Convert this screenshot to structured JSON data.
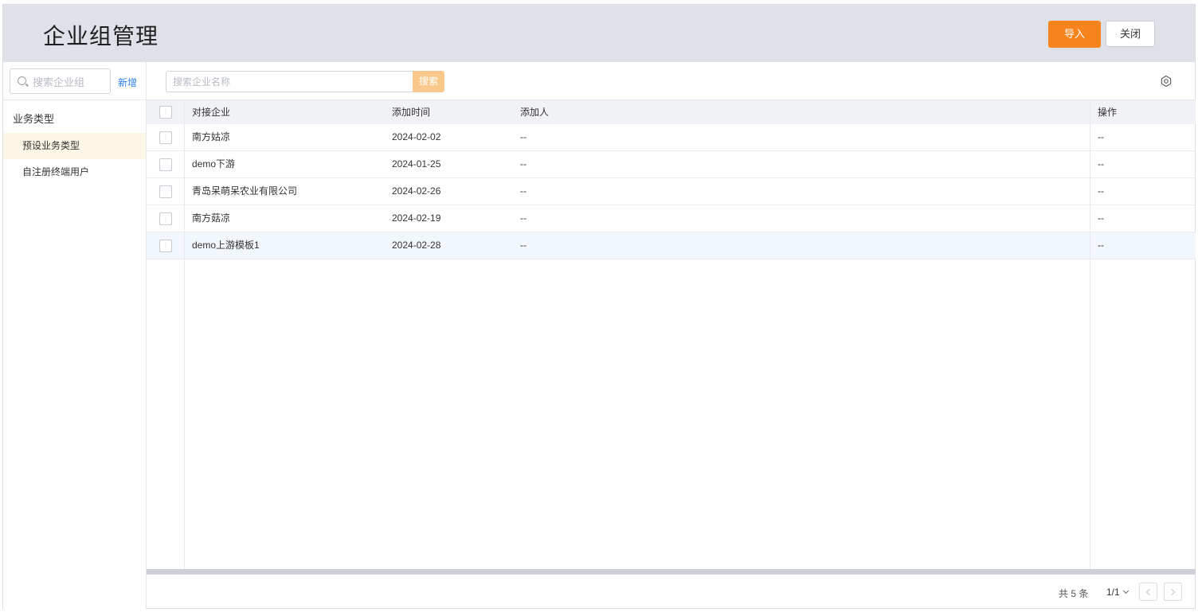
{
  "header": {
    "title": "企业组管理",
    "import_label": "导入",
    "close_label": "关闭"
  },
  "sidebar": {
    "search_placeholder": "搜索企业组",
    "add_label": "新增",
    "group_title": "业务类型",
    "items": [
      {
        "label": "预设业务类型",
        "active": true
      },
      {
        "label": "自注册终端用户",
        "active": false
      }
    ]
  },
  "toolbar": {
    "search_placeholder": "搜索企业名称",
    "search_label": "搜索",
    "settings_icon": "settings-icon"
  },
  "table": {
    "columns": [
      "对接企业",
      "添加时间",
      "添加人",
      "操作"
    ],
    "rows": [
      {
        "company": "南方姑凉",
        "time": "2024-02-02",
        "adder": "--",
        "action": "--"
      },
      {
        "company": "demo下游",
        "time": "2024-01-25",
        "adder": "--",
        "action": "--"
      },
      {
        "company": "青岛呆萌呆农业有限公司",
        "time": "2024-02-26",
        "adder": "--",
        "action": "--"
      },
      {
        "company": "南方菇凉",
        "time": "2024-02-19",
        "adder": "--",
        "action": "--"
      },
      {
        "company": "demo上游模板1",
        "time": "2024-02-28",
        "adder": "--",
        "action": "--"
      }
    ]
  },
  "pagination": {
    "total_text": "共 5 条",
    "page_text": "1/1"
  },
  "colors": {
    "primary": "#f7841d",
    "search_button": "#f9c98c",
    "link": "#2d7ef0",
    "active_item_bg": "#fdf5e6"
  }
}
